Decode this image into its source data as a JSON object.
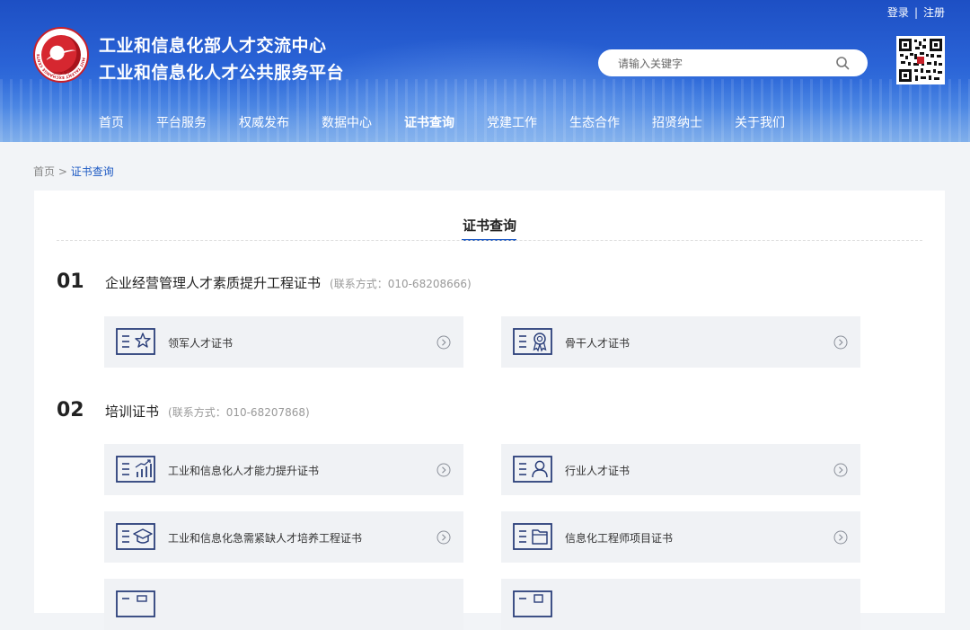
{
  "header": {
    "login": "登录",
    "separator": "|",
    "register": "注册",
    "logo_ring_text": "MIIT TALENT EXCHANGE CENTER",
    "logo_bottom_text": "工信人才",
    "title_line1": "工业和信息化部人才交流中心",
    "title_line2": "工业和信息化人才公共服务平台",
    "search_placeholder": "请输入关键字",
    "nav": [
      {
        "label": "首页"
      },
      {
        "label": "平台服务"
      },
      {
        "label": "权威发布"
      },
      {
        "label": "数据中心"
      },
      {
        "label": "证书查询",
        "active": true
      },
      {
        "label": "党建工作"
      },
      {
        "label": "生态合作"
      },
      {
        "label": "招贤纳士"
      },
      {
        "label": "关于我们"
      }
    ]
  },
  "breadcrumb": {
    "home": "首页",
    "separator": ">",
    "current": "证书查询"
  },
  "page_title": "证书查询",
  "sections": [
    {
      "number": "01",
      "name": "企业经营管理人才素质提升工程证书",
      "contact": "(联系方式：010-68208666)",
      "items": [
        {
          "label": "领军人才证书",
          "icon": "star-certificate-icon"
        },
        {
          "label": "骨干人才证书",
          "icon": "medal-certificate-icon"
        }
      ]
    },
    {
      "number": "02",
      "name": "培训证书",
      "contact": "(联系方式：010-68207868)",
      "items": [
        {
          "label": "工业和信息化人才能力提升证书",
          "icon": "growth-chart-icon"
        },
        {
          "label": "行业人才证书",
          "icon": "person-icon"
        },
        {
          "label": "工业和信息化急需紧缺人才培养工程证书",
          "icon": "graduation-cap-icon"
        },
        {
          "label": "信息化工程师项目证书",
          "icon": "folder-icon"
        }
      ]
    }
  ],
  "colors": {
    "brand_blue": "#1f5bc4",
    "icon_blue": "#2b3f7a",
    "card_bg": "#f0f2f5",
    "logo_red": "#c8202a"
  }
}
